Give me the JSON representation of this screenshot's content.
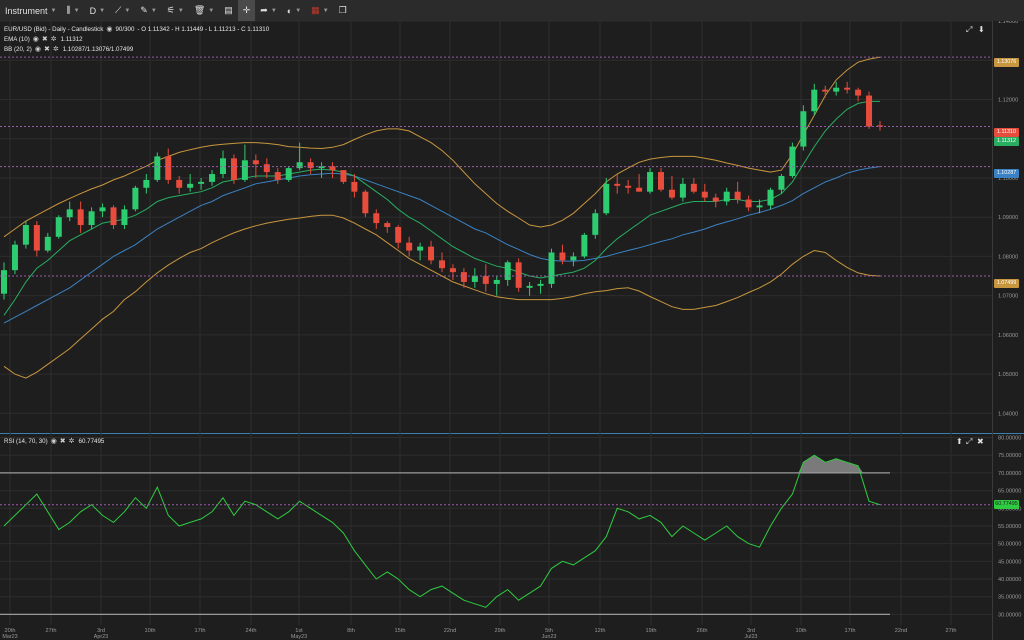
{
  "toolbar": {
    "instrument": "Instrument",
    "period": "D",
    "items": [
      {
        "name": "candle-type-icon",
        "glyph": "⫼"
      },
      {
        "name": "drawing-line-icon",
        "glyph": "⟋"
      },
      {
        "name": "ruler-icon",
        "glyph": "✎"
      },
      {
        "name": "indicators-icon",
        "glyph": "⚟"
      },
      {
        "name": "trash-icon",
        "glyph": "🗑"
      },
      {
        "name": "layout-icon",
        "glyph": "▤"
      },
      {
        "name": "crosshair-icon",
        "glyph": "✛"
      },
      {
        "name": "share-icon",
        "glyph": "➦"
      },
      {
        "name": "theme-icon",
        "glyph": "◐"
      },
      {
        "name": "language-flag-icon",
        "glyph": "▦"
      },
      {
        "name": "window-icon",
        "glyph": "❐"
      }
    ]
  },
  "legends": {
    "main": "EUR/USD (Bid) - Daily - Candlestick",
    "main_count": "90/300",
    "main_ohlc": "- O 1.11342 - H 1.11449 - L 1.11213 - C 1.11310",
    "ema_label": "EMA (10)",
    "ema_value": "1.11312",
    "bb_label": "BB (20, 2)",
    "bb_value": "1.10287/1.13076/1.07499",
    "rsi_label": "RSI (14, 70, 30)",
    "rsi_value": "60.77495"
  },
  "price_tags": {
    "bb_upper": "1.13076",
    "close": "1.11310",
    "ema": "1.11312",
    "bb_mid": "1.10287",
    "bb_lower": "1.07499",
    "rsi": "60.77495"
  },
  "colors": {
    "bg": "#1e1e1e",
    "grid": "#2d2d2d",
    "up": "#2ecc71",
    "down": "#e74c3c",
    "ema": "#27ae60",
    "bb_band": "#c8963e",
    "bb_mid": "#3b82c4",
    "rsi": "#2ecc40",
    "level": "#9a5ca8"
  },
  "chart_data": [
    {
      "type": "candlestick",
      "title": "EUR/USD (Bid) - Daily - Candlestick",
      "ylim": [
        1.035,
        1.14
      ],
      "y_ticks": [
        "1.14000",
        "1.13000",
        "1.12000",
        "1.11000",
        "1.10000",
        "1.09000",
        "1.08000",
        "1.07000",
        "1.06000",
        "1.05000",
        "1.04000"
      ],
      "x_labels": [
        "20th",
        "27th",
        "3rd",
        "10th",
        "17th",
        "24th",
        "1st",
        "8th",
        "15th",
        "22nd",
        "29th",
        "5th",
        "12th",
        "19th",
        "26th",
        "3rd",
        "10th",
        "17th",
        "22nd",
        "27th"
      ],
      "x_sublabels": [
        "Mar23",
        "",
        "Apr23",
        "",
        "",
        "",
        "May23",
        "",
        "",
        "",
        "",
        "Jun23",
        "",
        "",
        "",
        "Jul23",
        "",
        "",
        "",
        ""
      ],
      "candles": [
        [
          1.0705,
          1.0785,
          1.069,
          1.0765
        ],
        [
          1.0765,
          1.084,
          1.0755,
          1.083
        ],
        [
          1.083,
          1.089,
          1.082,
          1.088
        ],
        [
          1.088,
          1.089,
          1.08,
          1.0815
        ],
        [
          1.0815,
          1.086,
          1.081,
          1.085
        ],
        [
          1.085,
          1.0905,
          1.0845,
          1.09
        ],
        [
          1.09,
          1.094,
          1.089,
          1.092
        ],
        [
          1.092,
          1.094,
          1.086,
          1.088
        ],
        [
          1.088,
          1.0925,
          1.087,
          1.0915
        ],
        [
          1.0915,
          1.0935,
          1.09,
          1.0925
        ],
        [
          1.0925,
          1.093,
          1.087,
          1.088
        ],
        [
          1.088,
          1.093,
          1.087,
          1.092
        ],
        [
          1.092,
          1.098,
          1.0915,
          1.0975
        ],
        [
          1.0975,
          1.101,
          1.096,
          1.0995
        ],
        [
          1.0995,
          1.1065,
          1.099,
          1.1055
        ],
        [
          1.1055,
          1.1075,
          1.0985,
          1.0995
        ],
        [
          1.0995,
          1.1005,
          1.096,
          1.0975
        ],
        [
          1.0975,
          1.101,
          1.0965,
          1.0985
        ],
        [
          1.0985,
          1.1,
          1.097,
          1.099
        ],
        [
          1.099,
          1.102,
          1.098,
          1.101
        ],
        [
          1.101,
          1.107,
          1.1,
          1.105
        ],
        [
          1.105,
          1.106,
          1.0985,
          1.0995
        ],
        [
          1.0995,
          1.1085,
          1.099,
          1.1045
        ],
        [
          1.1045,
          1.106,
          1.1,
          1.1035
        ],
        [
          1.1035,
          1.105,
          1.1,
          1.1015
        ],
        [
          1.1015,
          1.1025,
          1.0985,
          1.0995
        ],
        [
          1.0995,
          1.103,
          1.099,
          1.1025
        ],
        [
          1.1025,
          1.109,
          1.102,
          1.104
        ],
        [
          1.104,
          1.105,
          1.101,
          1.1025
        ],
        [
          1.1025,
          1.104,
          1.1,
          1.103
        ],
        [
          1.103,
          1.104,
          1.1,
          1.102
        ],
        [
          1.102,
          1.101,
          1.0985,
          1.099
        ],
        [
          1.099,
          1.101,
          1.095,
          1.0965
        ],
        [
          1.0965,
          1.097,
          1.09,
          1.091
        ],
        [
          1.091,
          1.092,
          1.087,
          1.0885
        ],
        [
          1.0885,
          1.089,
          1.086,
          1.0875
        ],
        [
          1.0875,
          1.088,
          1.082,
          1.0835
        ],
        [
          1.0835,
          1.085,
          1.08,
          1.0815
        ],
        [
          1.0815,
          1.0835,
          1.079,
          1.0825
        ],
        [
          1.0825,
          1.084,
          1.078,
          1.079
        ],
        [
          1.079,
          1.081,
          1.076,
          1.077
        ],
        [
          1.077,
          1.078,
          1.074,
          1.076
        ],
        [
          1.076,
          1.077,
          1.072,
          1.0735
        ],
        [
          1.0735,
          1.077,
          1.072,
          1.075
        ],
        [
          1.075,
          1.078,
          1.071,
          1.073
        ],
        [
          1.073,
          1.075,
          1.07,
          1.074
        ],
        [
          1.074,
          1.079,
          1.0725,
          1.0785
        ],
        [
          1.0785,
          1.0795,
          1.071,
          1.072
        ],
        [
          1.072,
          1.0735,
          1.07,
          1.0725
        ],
        [
          1.0725,
          1.074,
          1.0705,
          1.073
        ],
        [
          1.073,
          1.082,
          1.072,
          1.081
        ],
        [
          1.081,
          1.083,
          1.078,
          1.079
        ],
        [
          1.079,
          1.081,
          1.0775,
          1.08
        ],
        [
          1.08,
          1.086,
          1.0795,
          1.0855
        ],
        [
          1.0855,
          1.092,
          1.0845,
          1.091
        ],
        [
          1.091,
          1.1,
          1.0905,
          1.0985
        ],
        [
          1.0985,
          1.101,
          1.096,
          1.098
        ],
        [
          1.098,
          1.0995,
          1.096,
          1.0975
        ],
        [
          1.0975,
          1.101,
          1.0965,
          1.0965
        ],
        [
          1.0965,
          1.1025,
          1.096,
          1.1015
        ],
        [
          1.1015,
          1.1025,
          1.0965,
          1.097
        ],
        [
          1.097,
          1.1005,
          1.0945,
          1.095
        ],
        [
          1.095,
          1.1,
          1.094,
          1.0985
        ],
        [
          1.0985,
          1.1,
          1.096,
          1.0965
        ],
        [
          1.0965,
          1.0985,
          1.094,
          1.095
        ],
        [
          1.095,
          1.096,
          1.0925,
          1.094
        ],
        [
          1.094,
          1.0975,
          1.093,
          1.0965
        ],
        [
          1.0965,
          1.099,
          1.0935,
          1.0945
        ],
        [
          1.0945,
          1.0955,
          1.0915,
          1.0925
        ],
        [
          1.0925,
          1.0945,
          1.091,
          1.093
        ],
        [
          1.093,
          1.0975,
          1.092,
          1.097
        ],
        [
          1.097,
          1.101,
          1.096,
          1.1005
        ],
        [
          1.1005,
          1.109,
          1.1,
          1.108
        ],
        [
          1.108,
          1.1185,
          1.107,
          1.117
        ],
        [
          1.117,
          1.124,
          1.116,
          1.1225
        ],
        [
          1.1225,
          1.1235,
          1.1205,
          1.122
        ],
        [
          1.122,
          1.1245,
          1.121,
          1.123
        ],
        [
          1.123,
          1.1245,
          1.1215,
          1.1225
        ],
        [
          1.1225,
          1.123,
          1.1195,
          1.121
        ],
        [
          1.121,
          1.122,
          1.1125,
          1.1131
        ],
        [
          1.1134,
          1.1145,
          1.1121,
          1.1131
        ]
      ],
      "ema10": [
        1.065,
        1.069,
        1.0735,
        1.077,
        1.079,
        1.0815,
        1.084,
        1.0855,
        1.087,
        1.0885,
        1.089,
        1.0895,
        1.0905,
        1.092,
        1.094,
        1.095,
        1.0955,
        1.096,
        1.0965,
        1.0975,
        1.099,
        1.0995,
        1.1,
        1.1005,
        1.1005,
        1.1005,
        1.101,
        1.1015,
        1.102,
        1.1022,
        1.102,
        1.1015,
        1.1005,
        1.0985,
        1.0965,
        1.0945,
        1.092,
        1.09,
        1.0885,
        1.0865,
        1.0845,
        1.0825,
        1.081,
        1.0795,
        1.0785,
        1.0775,
        1.077,
        1.076,
        1.075,
        1.0745,
        1.075,
        1.0755,
        1.076,
        1.077,
        1.079,
        1.082,
        1.0845,
        1.0865,
        1.0885,
        1.0905,
        1.0915,
        1.0925,
        1.0935,
        1.094,
        1.094,
        1.094,
        1.0945,
        1.0945,
        1.094,
        1.094,
        1.0945,
        1.096,
        1.099,
        1.1035,
        1.108,
        1.112,
        1.115,
        1.1175,
        1.119,
        1.1195,
        1.1195
      ],
      "bb_mid": [
        1.063,
        1.0645,
        1.066,
        1.0675,
        1.069,
        1.0705,
        1.072,
        1.074,
        1.076,
        1.078,
        1.08,
        1.0815,
        1.083,
        1.085,
        1.087,
        1.0885,
        1.09,
        1.0915,
        1.093,
        1.094,
        1.0955,
        1.0965,
        1.0975,
        1.0985,
        1.099,
        1.0995,
        1.1,
        1.1005,
        1.1008,
        1.101,
        1.1012,
        1.101,
        1.1005,
        1.0995,
        1.0985,
        1.0975,
        1.0965,
        1.0955,
        1.0945,
        1.093,
        1.0915,
        1.09,
        1.0885,
        1.087,
        1.086,
        1.0845,
        1.083,
        1.0818,
        1.0805,
        1.0795,
        1.079,
        1.0788,
        1.0788,
        1.079,
        1.0795,
        1.08,
        1.0808,
        1.0815,
        1.0822,
        1.083,
        1.0838,
        1.0845,
        1.0855,
        1.0862,
        1.087,
        1.088,
        1.0888,
        1.0896,
        1.0905,
        1.0912,
        1.092,
        1.093,
        1.0942,
        1.096,
        1.0975,
        1.099,
        1.1,
        1.1012,
        1.102,
        1.1025,
        1.1029
      ],
      "bb_upper": [
        1.085,
        1.087,
        1.089,
        1.0905,
        1.092,
        1.0935,
        1.0948,
        1.096,
        1.0972,
        1.0982,
        1.0995,
        1.1005,
        1.1018,
        1.103,
        1.1045,
        1.1055,
        1.1065,
        1.1072,
        1.1078,
        1.1083,
        1.1086,
        1.1088,
        1.109,
        1.109,
        1.1088,
        1.1085,
        1.108,
        1.1078,
        1.1076,
        1.1075,
        1.1078,
        1.1085,
        1.1098,
        1.111,
        1.112,
        1.1125,
        1.1125,
        1.112,
        1.1105,
        1.109,
        1.107,
        1.1045,
        1.1015,
        1.0985,
        1.096,
        1.0935,
        1.0915,
        1.0898,
        1.088,
        1.0875,
        1.088,
        1.0892,
        1.091,
        1.0935,
        1.096,
        1.099,
        1.101,
        1.1025,
        1.104,
        1.1048,
        1.1052,
        1.1055,
        1.1055,
        1.1055,
        1.105,
        1.1045,
        1.1038,
        1.1032,
        1.1025,
        1.102,
        1.1015,
        1.102,
        1.106,
        1.111,
        1.116,
        1.121,
        1.125,
        1.1275,
        1.1295,
        1.1303,
        1.1308
      ],
      "bb_lower": [
        1.052,
        1.05,
        1.049,
        1.0505,
        1.0525,
        1.0545,
        1.0565,
        1.059,
        1.0615,
        1.064,
        1.066,
        1.069,
        1.071,
        1.0735,
        1.0758,
        1.0778,
        1.0795,
        1.081,
        1.082,
        1.0835,
        1.0848,
        1.086,
        1.087,
        1.0878,
        1.0885,
        1.089,
        1.0895,
        1.0898,
        1.0902,
        1.0905,
        1.0905,
        1.0898,
        1.0885,
        1.087,
        1.0855,
        1.0835,
        1.0815,
        1.0795,
        1.078,
        1.0765,
        1.075,
        1.0735,
        1.0725,
        1.0715,
        1.0705,
        1.0697,
        1.0693,
        1.069,
        1.069,
        1.069,
        1.069,
        1.0693,
        1.0698,
        1.0705,
        1.071,
        1.0713,
        1.0718,
        1.072,
        1.0712,
        1.0698,
        1.0685,
        1.0672,
        1.0665,
        1.0665,
        1.067,
        1.0675,
        1.0685,
        1.0695,
        1.0708,
        1.072,
        1.0735,
        1.0755,
        1.078,
        1.08,
        1.0815,
        1.081,
        1.079,
        1.0772,
        1.0758,
        1.0752,
        1.075
      ]
    },
    {
      "type": "line",
      "title": "RSI (14, 70, 30)",
      "ylim": [
        27,
        81
      ],
      "y_ticks": [
        "80.00000",
        "75.00000",
        "70.00000",
        "65.00000",
        "60.00000",
        "55.00000",
        "50.00000",
        "45.00000",
        "40.00000",
        "35.00000",
        "30.00000"
      ],
      "levels": [
        70,
        30
      ],
      "values": [
        55,
        58,
        61,
        64,
        59,
        54,
        56,
        59,
        61,
        58,
        56,
        59,
        63,
        60,
        66,
        58,
        55,
        56,
        57,
        59,
        63,
        58,
        62,
        61,
        59,
        57,
        59,
        62,
        60,
        58,
        56,
        53,
        48,
        44,
        40,
        42,
        40,
        37,
        35,
        37,
        38,
        36,
        34,
        33,
        32,
        35,
        37,
        34,
        36,
        38,
        43,
        45,
        44,
        46,
        48,
        52,
        60,
        59,
        57,
        58,
        56,
        52,
        55,
        53,
        51,
        53,
        55,
        52,
        50,
        49,
        55,
        60,
        64,
        73,
        75,
        73,
        74,
        73,
        72,
        62,
        61
      ]
    }
  ]
}
